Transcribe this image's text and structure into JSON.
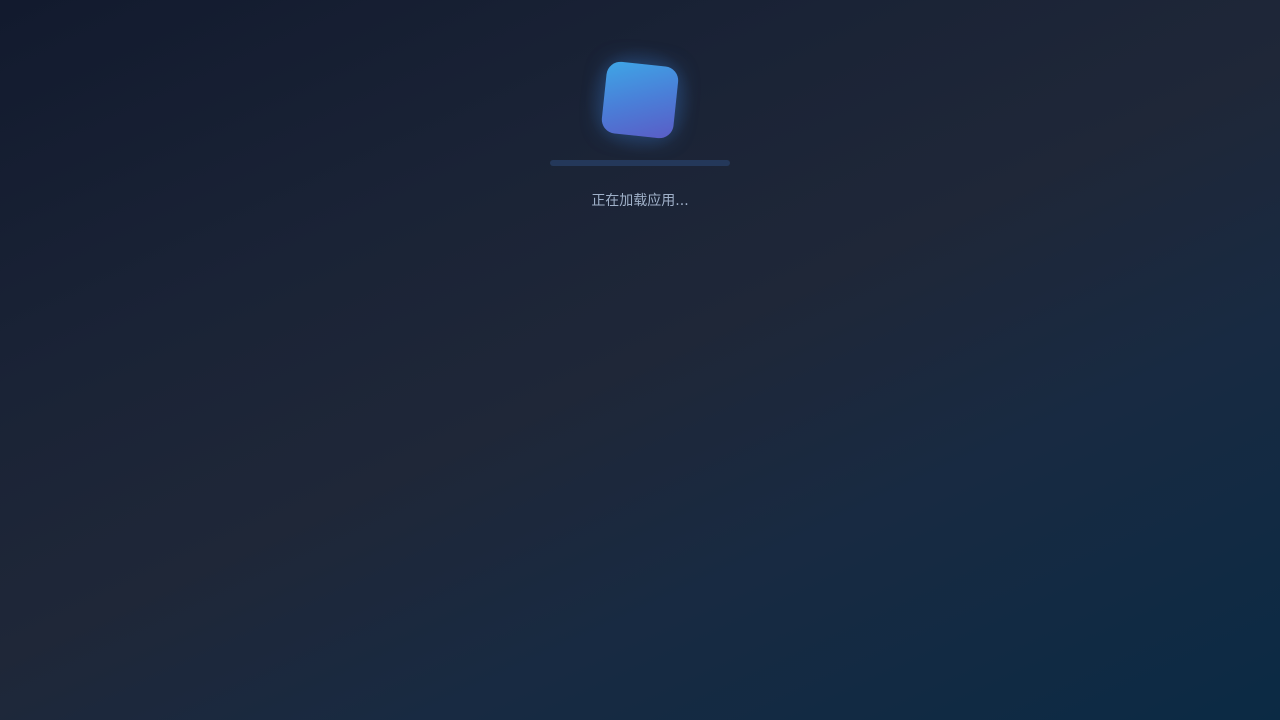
{
  "splash": {
    "logo_icon": "app-logo-icon",
    "status_text": "正在加载应用...",
    "progress": 0,
    "colors": {
      "accent_start": "#3ea6e6",
      "accent_end": "#5a5cc6",
      "status_text": "#9fb0c8"
    }
  }
}
